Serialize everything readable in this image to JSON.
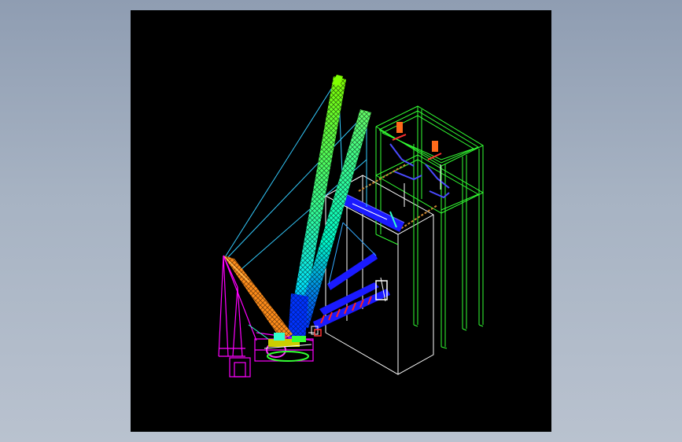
{
  "viewer": {
    "background_color": "#000000",
    "page_color": "#a7b3c3"
  },
  "drawing": {
    "colors": {
      "crane_main_boom": "#7fff00",
      "crane_main_boom_lower": "#00ffcc",
      "crane_base_boom": "#0033ff",
      "crane_mast": "#ff8c1a",
      "counterweight_frame": "#ff00ff",
      "cables": "#33ccff",
      "steel_structure": "#33ff33",
      "building_outline": "#ffffff",
      "lifted_beam": "#1a1aff",
      "rigging_red": "#ff2020"
    }
  }
}
